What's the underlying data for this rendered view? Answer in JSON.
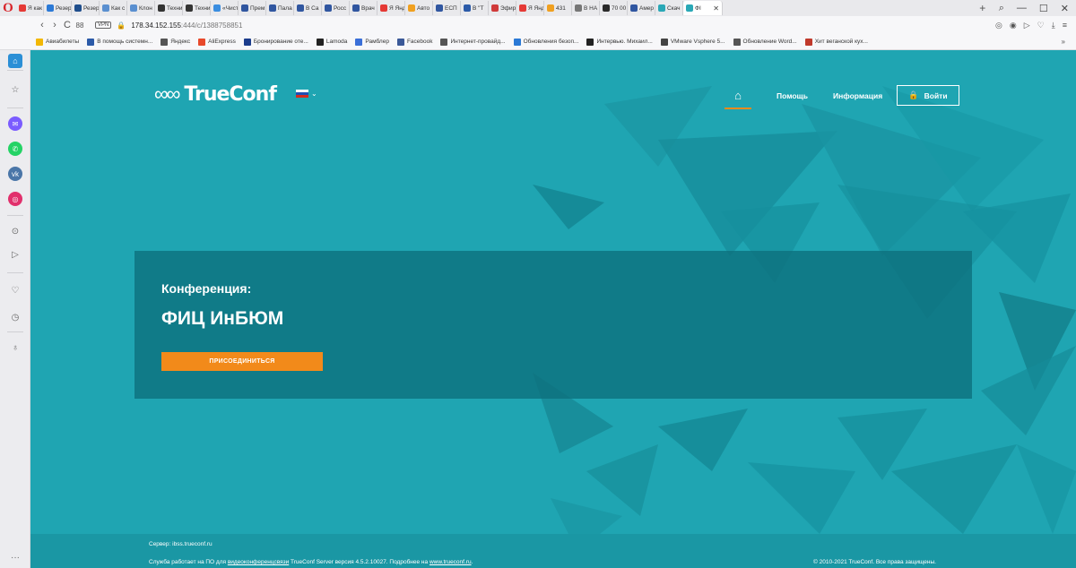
{
  "browser": {
    "tabs": [
      {
        "label": "Я как с",
        "color": "#e53935"
      },
      {
        "label": "Резер",
        "color": "#2b79d6"
      },
      {
        "label": "Резер",
        "color": "#1f4e8c"
      },
      {
        "label": "Как с",
        "color": "#5a8fd0"
      },
      {
        "label": "Клон",
        "color": "#5a8fd0"
      },
      {
        "label": "Техни",
        "color": "#333333"
      },
      {
        "label": "Техни",
        "color": "#333333"
      },
      {
        "label": "«Чист",
        "color": "#3a8de0"
      },
      {
        "label": "Прем",
        "color": "#3056a0"
      },
      {
        "label": "Пала",
        "color": "#3056a0"
      },
      {
        "label": "В Са",
        "color": "#3056a0"
      },
      {
        "label": "Росс",
        "color": "#3056a0"
      },
      {
        "label": "Врач",
        "color": "#3056a0"
      },
      {
        "label": "Я Янде",
        "color": "#e53935"
      },
      {
        "label": "Авто",
        "color": "#f0a020"
      },
      {
        "label": "ЕСП",
        "color": "#3056a0"
      },
      {
        "label": "В \"Т",
        "color": "#2b5aa8"
      },
      {
        "label": "Эфир",
        "color": "#d03a3a"
      },
      {
        "label": "Я Янде",
        "color": "#e53935"
      },
      {
        "label": "431",
        "color": "#f0a020"
      },
      {
        "label": "В НА",
        "color": "#777777"
      },
      {
        "label": "70 00",
        "color": "#2a2a2a"
      },
      {
        "label": "Амер",
        "color": "#3056a0"
      },
      {
        "label": "Скач",
        "color": "#2aa8b6"
      },
      {
        "label": "ФІ",
        "color": "#2aa8b6",
        "active": true
      }
    ],
    "new_tab": "+",
    "window_controls": {
      "search": "⌕",
      "minimize": "—",
      "maximize": "☐",
      "close": "✕"
    },
    "nav": {
      "back": "‹",
      "forward": "›",
      "reload": "C",
      "speed_dial": "88"
    },
    "vpn_label": "VPN",
    "url_host": "178.34.152.155",
    "url_path": ":444/c/1388758851",
    "address_icons": [
      "◎",
      "◉",
      "▷",
      "♡",
      "⤓",
      "≡"
    ],
    "bookmarks": [
      {
        "label": "Авиабилеты",
        "color": "#f2b705"
      },
      {
        "label": "В помощь системн...",
        "color": "#2b5aa8"
      },
      {
        "label": "Яндекс",
        "color": "#555555"
      },
      {
        "label": "AliExpress",
        "color": "#e8492b"
      },
      {
        "label": "Бронирование оте...",
        "color": "#1b3c8c"
      },
      {
        "label": "Lamoda",
        "color": "#222222"
      },
      {
        "label": "Рамблер",
        "color": "#3a6fd8"
      },
      {
        "label": "Facebook",
        "color": "#3b5998"
      },
      {
        "label": "Интернет-провайд...",
        "color": "#555555"
      },
      {
        "label": "Обновления безоп...",
        "color": "#2b79d6"
      },
      {
        "label": "Интервью. Михаил...",
        "color": "#222222"
      },
      {
        "label": "VMware Vsphere 5...",
        "color": "#444444"
      },
      {
        "label": "Обновление Word...",
        "color": "#555555"
      },
      {
        "label": "Хит веганской кух...",
        "color": "#c0392b"
      }
    ],
    "bookmarks_more": "»"
  },
  "sidebar": {
    "items": [
      {
        "name": "home-icon",
        "glyph": "⌂"
      },
      {
        "name": "bookmark-star-icon",
        "glyph": "☆"
      },
      {
        "name": "messenger-icon",
        "glyph": "✉",
        "color": "#7b5cff"
      },
      {
        "name": "whatsapp-icon",
        "glyph": "✆",
        "color": "#25d366"
      },
      {
        "name": "vk-icon",
        "glyph": "vk",
        "color": "#4a76a8"
      },
      {
        "name": "instagram-icon",
        "glyph": "◎",
        "color": "#e1306c"
      },
      {
        "name": "player-icon",
        "glyph": "⊙"
      },
      {
        "name": "send-icon",
        "glyph": "▷"
      },
      {
        "name": "heart-icon",
        "glyph": "♡"
      },
      {
        "name": "history-icon",
        "glyph": "◷"
      },
      {
        "name": "settings-icon",
        "glyph": "♁"
      },
      {
        "name": "more-icon",
        "glyph": "···"
      }
    ]
  },
  "site": {
    "logo_text": "TrueConf",
    "nav": {
      "home_icon": "⌂",
      "help": "Помощь",
      "info": "Информация",
      "login": "Войти",
      "login_icon": "🔒"
    },
    "conference": {
      "label": "Конференция:",
      "name": "ФИЦ ИнБЮМ",
      "join_button": "ПРИСОЕДИНИТЬСЯ"
    },
    "footer": {
      "server": "Сервер: ibss.trueconf.ru",
      "info_prefix": "Служба работает на ПО для ",
      "info_link": "видеоконференцсвязи",
      "info_middle": " TrueConf Server версия 4.5.2.10027. Подробнее на ",
      "info_site": "www.trueconf.ru",
      "info_suffix": ".",
      "copyright": "© 2010-2021 TrueConf. Все права защищены."
    },
    "colors": {
      "background": "#1fa5b2",
      "panel": "#0d707c",
      "accent_orange": "#f28a1a",
      "footer": "#1a97a4"
    }
  }
}
